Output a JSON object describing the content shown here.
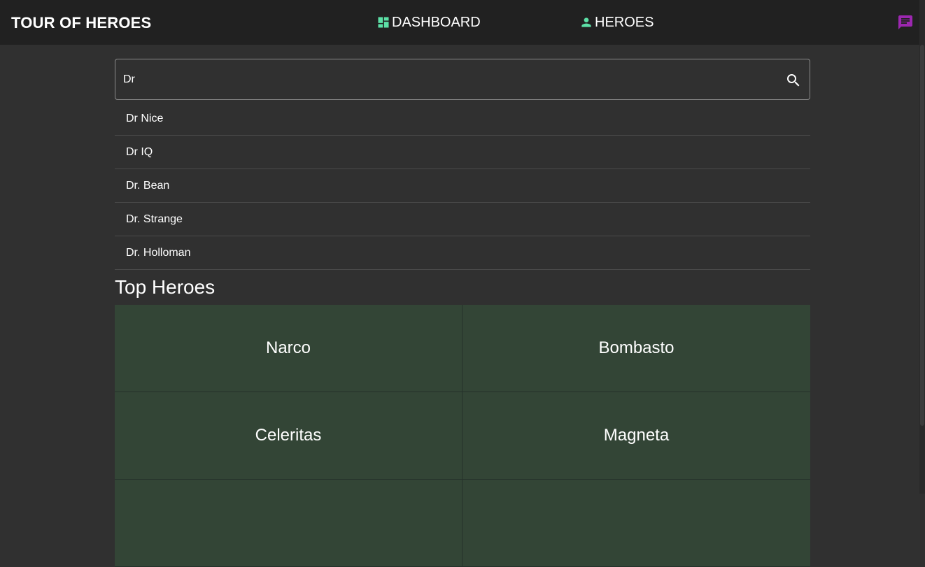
{
  "header": {
    "title": "TOUR OF HEROES",
    "nav": [
      {
        "label": "DASHBOARD",
        "icon": "dashboard-icon"
      },
      {
        "label": "HEROES",
        "icon": "person-icon"
      }
    ],
    "messages_icon": "message-icon"
  },
  "search": {
    "value": "Dr",
    "icon": "search-icon",
    "results": [
      "Dr Nice",
      "Dr IQ",
      "Dr. Bean",
      "Dr. Strange",
      "Dr. Holloman"
    ]
  },
  "dashboard": {
    "title": "Top Heroes",
    "heroes": [
      "Narco",
      "Bombasto",
      "Celeritas",
      "Magneta",
      "",
      ""
    ]
  },
  "colors": {
    "accent_green": "#5ce0a6",
    "accent_purple": "#9c27b0",
    "topbar_bg": "#212121",
    "page_bg": "#303030",
    "tile_bg": "#334536"
  }
}
